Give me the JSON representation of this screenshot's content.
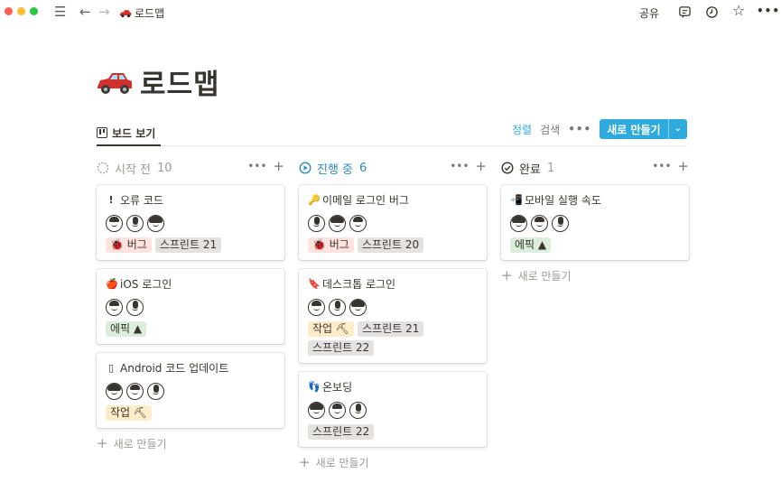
{
  "window": {
    "breadcrumb": "로드맵",
    "share_label": "공유",
    "icons": [
      "hamburger-icon",
      "back-arrow-icon",
      "forward-arrow-icon",
      "comment-icon",
      "clock-icon",
      "star-icon",
      "more-icon"
    ]
  },
  "page": {
    "title": "로드맵",
    "emoji": "red-car"
  },
  "view": {
    "tab_label": "보드 보기",
    "sort_label": "정렬",
    "search_label": "검색",
    "more_label": "•••",
    "new_label": "새로 만들기",
    "new_caret": "⌄"
  },
  "columns": [
    {
      "name": "시작 전",
      "count": "10",
      "status_icon": "circle-dashed-icon",
      "tools_more": "•••",
      "tools_add": "+",
      "cards": [
        {
          "icon": "!",
          "title": "오류 코드",
          "avatars": 3,
          "tags": [
            {
              "label": "🐞 버그",
              "color": "red"
            },
            {
              "label": "스프린트 21",
              "color": "gray"
            }
          ]
        },
        {
          "icon": "🍎",
          "title": "iOS 로그인",
          "avatars": 2,
          "tags": [
            {
              "label": "에픽 ▲",
              "color": "green"
            }
          ]
        },
        {
          "icon": "▯",
          "title": "Android 코드 업데이트",
          "avatars": 3,
          "tags": [
            {
              "label": "작업 ⛏",
              "color": "yellow"
            }
          ]
        }
      ],
      "new_label": "새로 만들기"
    },
    {
      "name": "진행 중",
      "count": "6",
      "status_icon": "play-circle-icon",
      "tools_more": "•••",
      "tools_add": "+",
      "cards": [
        {
          "icon": "🔑",
          "title": "이메일 로그인 버그",
          "avatars": 3,
          "tags": [
            {
              "label": "🐞 버그",
              "color": "red"
            },
            {
              "label": "스프린트 20",
              "color": "gray"
            }
          ]
        },
        {
          "icon": "🔖",
          "title": "데스크톱 로그인",
          "avatars": 3,
          "tags": [
            {
              "label": "작업 ⛏",
              "color": "yellow"
            },
            {
              "label": "스프린트 21",
              "color": "gray"
            },
            {
              "label": "스프린트 22",
              "color": "gray"
            }
          ]
        },
        {
          "icon": "👣",
          "title": "온보딩",
          "avatars": 3,
          "tags": [
            {
              "label": "스프린트 22",
              "color": "gray"
            }
          ]
        }
      ],
      "new_label": "새로 만들기"
    },
    {
      "name": "완료",
      "count": "1",
      "status_icon": "check-circle-icon",
      "tools_more": "•••",
      "tools_add": "+",
      "cards": [
        {
          "icon": "📲",
          "title": "모바일 실행 속도",
          "avatars": 3,
          "tags": [
            {
              "label": "에픽 ▲",
              "color": "green"
            }
          ]
        }
      ],
      "new_label": "새로 만들기"
    }
  ]
}
